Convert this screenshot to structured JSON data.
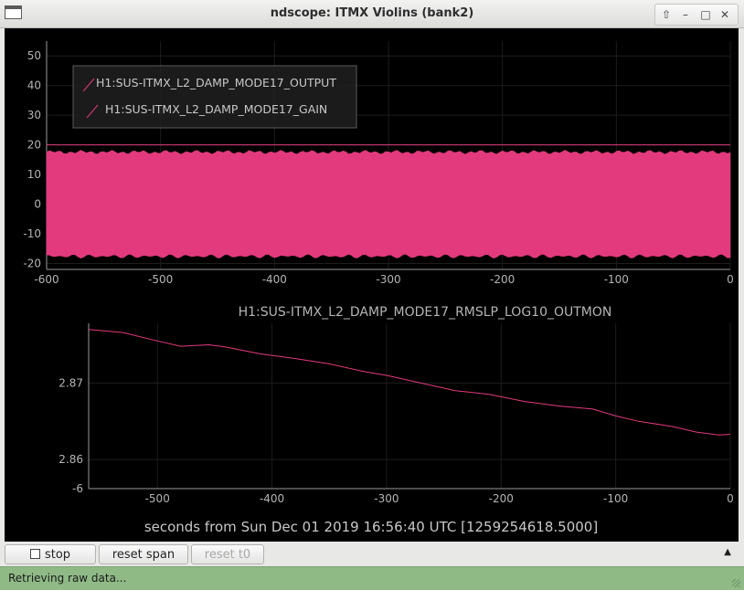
{
  "window": {
    "title": "ndscope: ITMX Violins (bank2)",
    "controls": [
      "up-arrow-icon",
      "minimize-icon",
      "maximize-icon",
      "close-icon"
    ]
  },
  "colors": {
    "plot_background": "#000000",
    "trace": "#e23a7c",
    "axis_text": "#b4b4b4",
    "status_background": "#8fba86"
  },
  "plot1": {
    "legend": [
      "H1:SUS-ITMX_L2_DAMP_MODE17_OUTPUT",
      "H1:SUS-ITMX_L2_DAMP_MODE17_GAIN"
    ],
    "y_ticks": [
      "50",
      "40",
      "30",
      "20",
      "10",
      "0",
      "-10",
      "-20"
    ],
    "x_ticks": [
      "-600",
      "-500",
      "-400",
      "-300",
      "-200",
      "-100",
      "0"
    ]
  },
  "plot2": {
    "title": "H1:SUS-ITMX_L2_DAMP_MODE17_RMSLP_LOG10_OUTMON",
    "y_ticks": [
      "2.87",
      "2.86",
      "-6"
    ],
    "x_ticks": [
      "-500",
      "-400",
      "-300",
      "-200",
      "-100",
      "0"
    ]
  },
  "x_axis_label": "seconds from Sun Dec 01 2019 16:56:40 UTC [1259254618.5000]",
  "chart_data": [
    {
      "type": "line",
      "series": [
        {
          "name": "H1:SUS-ITMX_L2_DAMP_MODE17_OUTPUT",
          "description_values": {
            "x_range": [
              -600,
              0
            ],
            "y_envelope": [
              -17.5,
              17.5
            ]
          }
        },
        {
          "name": "H1:SUS-ITMX_L2_DAMP_MODE17_GAIN",
          "x": [
            -600,
            0
          ],
          "y": [
            20,
            20
          ]
        }
      ],
      "xlim": [
        -600,
        0
      ],
      "ylim": [
        -22,
        55
      ],
      "legend_position": "top-left",
      "grid": true
    },
    {
      "type": "line",
      "title": "H1:SUS-ITMX_L2_DAMP_MODE17_RMSLP_LOG10_OUTMON",
      "series": [
        {
          "name": "H1:SUS-ITMX_L2_DAMP_MODE17_RMSLP_LOG10_OUTMON",
          "x": [
            -560,
            -530,
            -500,
            -480,
            -455,
            -440,
            -410,
            -380,
            -350,
            -320,
            -300,
            -270,
            -240,
            -210,
            -180,
            -150,
            -120,
            -100,
            -80,
            -50,
            -30,
            -10,
            0
          ],
          "y": [
            2.877,
            2.8766,
            2.8755,
            2.8748,
            2.875,
            2.8747,
            2.8738,
            2.8732,
            2.8725,
            2.8715,
            2.871,
            2.87,
            2.869,
            2.8685,
            2.8676,
            2.867,
            2.8666,
            2.8657,
            2.865,
            2.8643,
            2.8636,
            2.8632,
            2.8633
          ]
        }
      ],
      "xlim": [
        -560,
        0
      ],
      "ylim": [
        2.8562,
        2.8778
      ],
      "grid": true
    }
  ],
  "controls": {
    "stop_label": "stop",
    "reset_span_label": "reset span",
    "reset_t0_label": "reset t0"
  },
  "status": "Retrieving raw data..."
}
